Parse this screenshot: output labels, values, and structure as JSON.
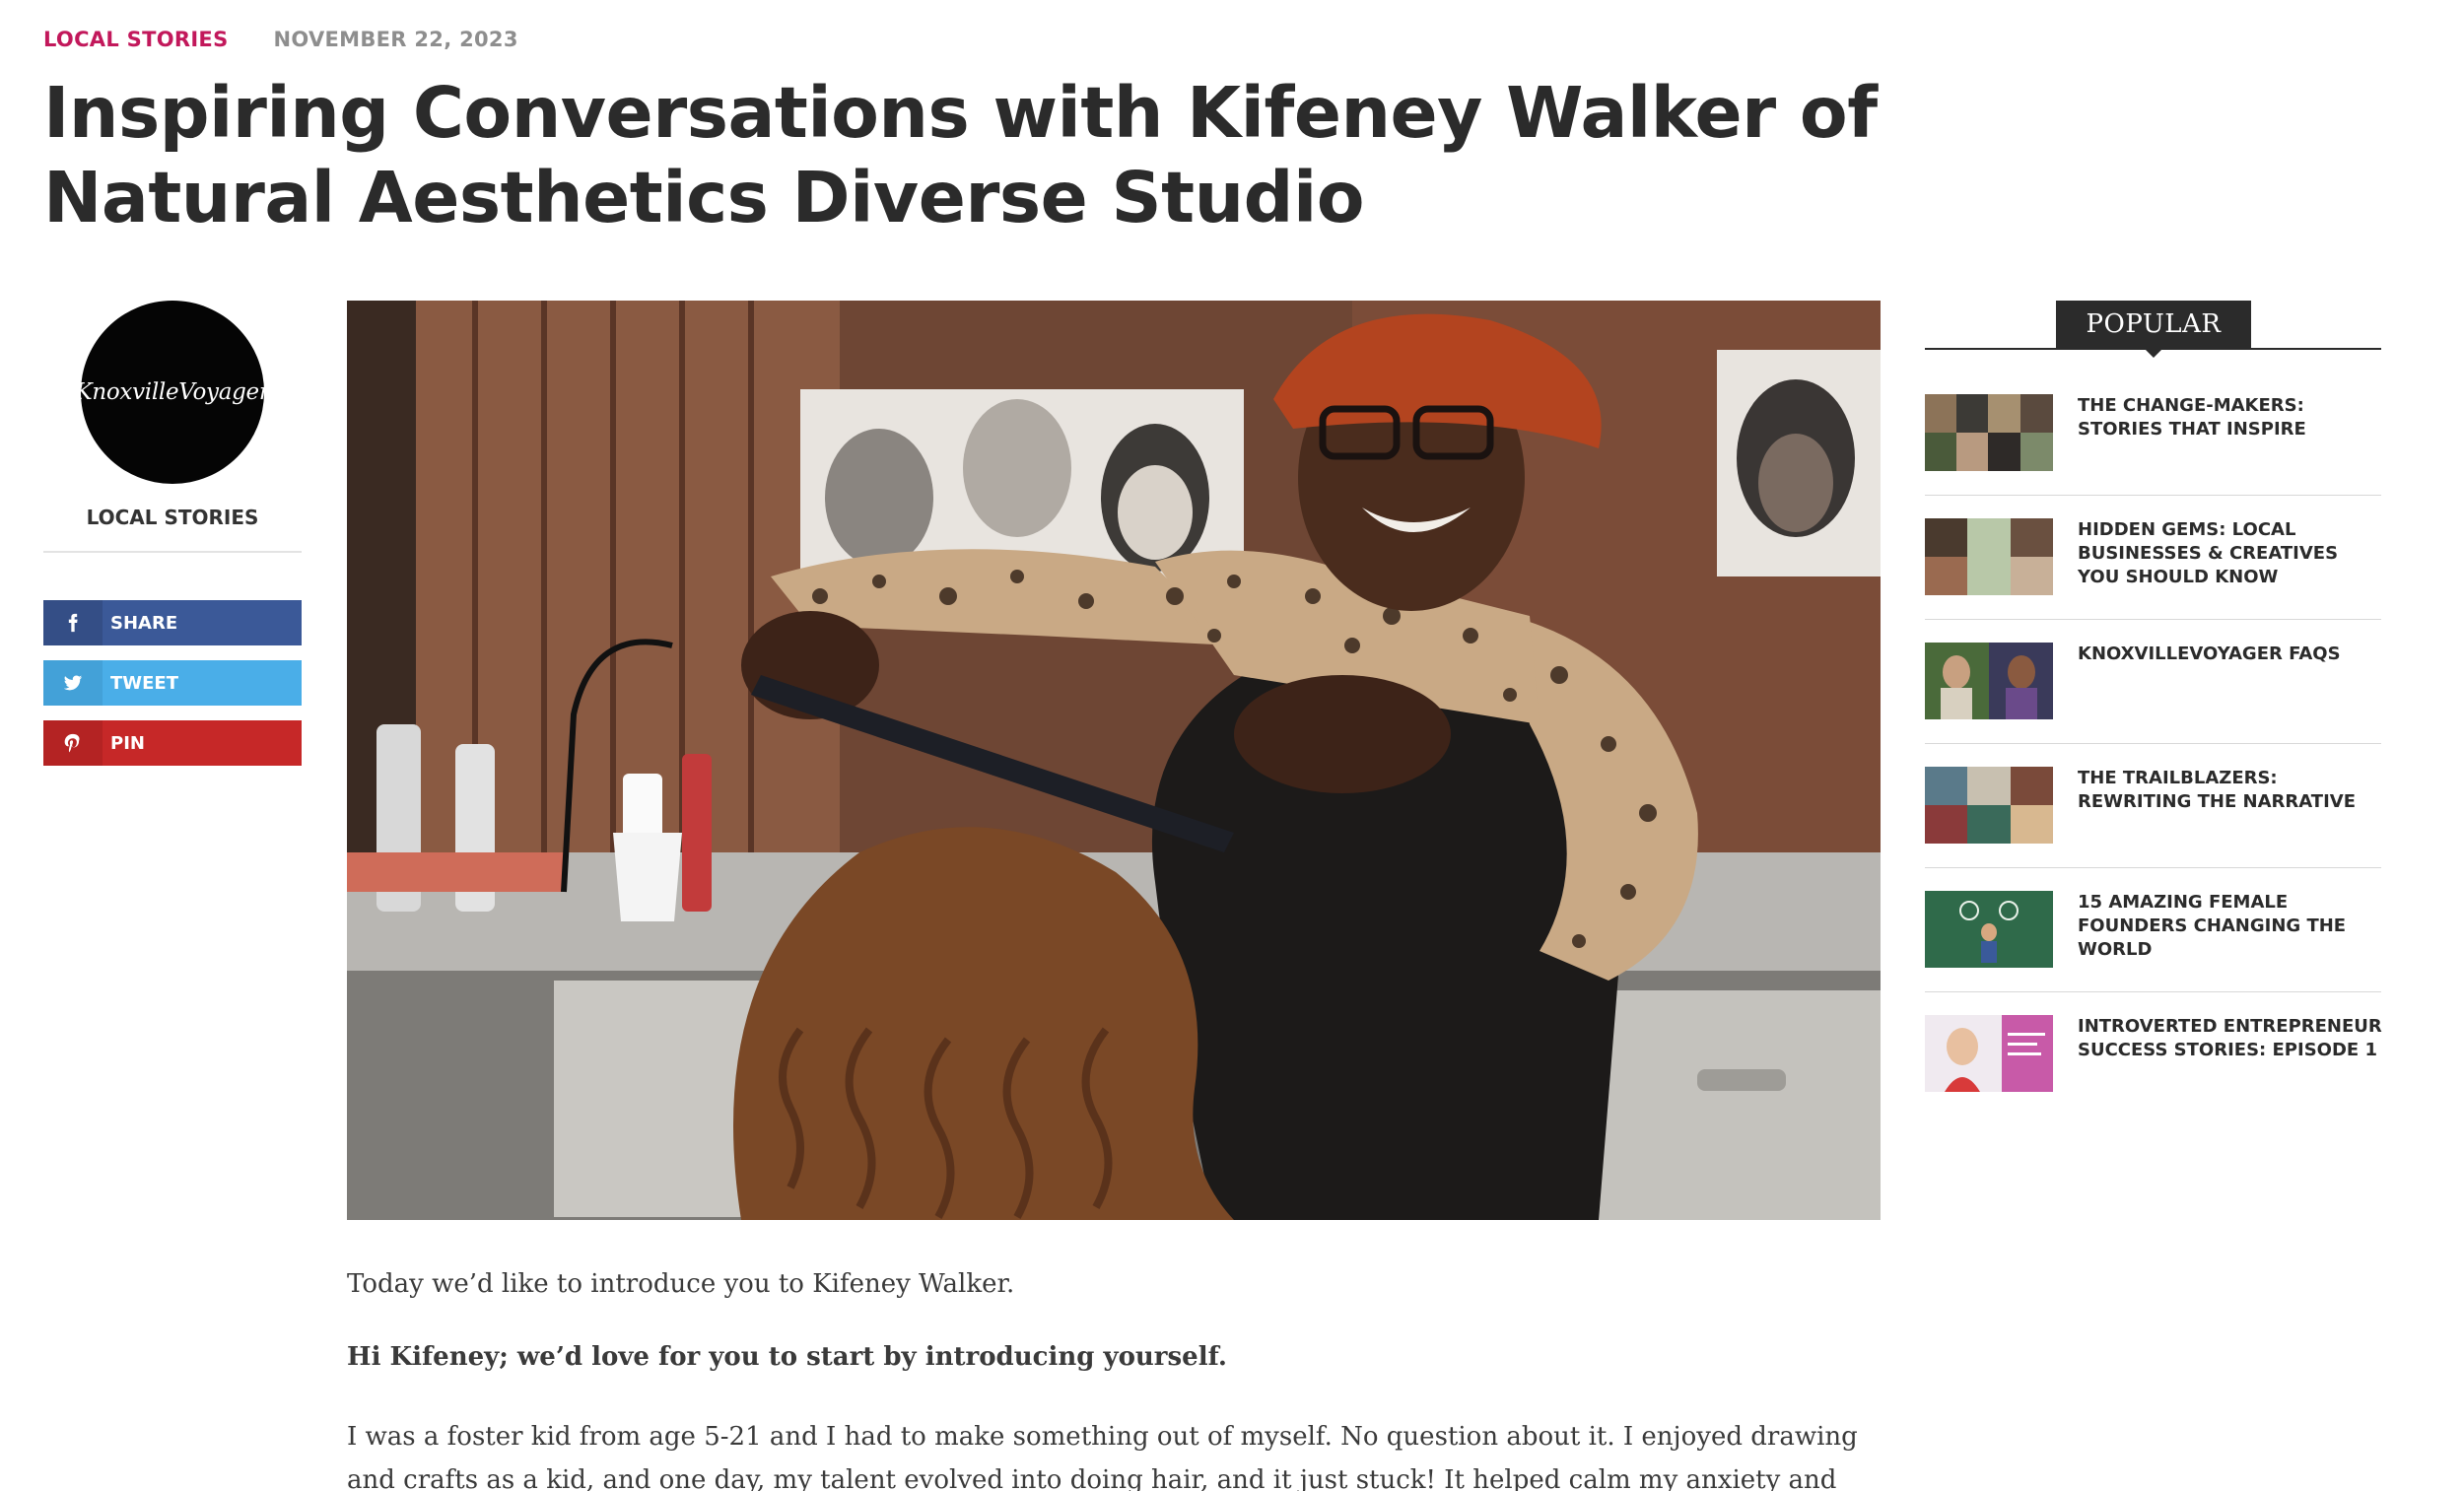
{
  "article": {
    "category": "LOCAL STORIES",
    "date": "NOVEMBER 22, 2023",
    "title": "Inspiring Conversations with Kifeney Walker of Natural Aesthetics Diverse Studio"
  },
  "author": {
    "logo_text": "KnoxvilleVoyager",
    "category": "LOCAL STORIES"
  },
  "share": {
    "facebook": {
      "label": "SHARE",
      "icon": "facebook-icon",
      "color": "#3b5998"
    },
    "twitter": {
      "label": "TWEET",
      "icon": "twitter-icon",
      "color": "#4aaee8"
    },
    "pinterest": {
      "label": "PIN",
      "icon": "pinterest-icon",
      "color": "#c62828"
    }
  },
  "body": {
    "intro": "Today we’d like to introduce you to Kifeney Walker.",
    "question": "Hi Kifeney; we’d love for you to start by introducing yourself.",
    "answer": "I was a foster kid from age 5-21 and I had to make something out of myself. No question about it. I enjoyed drawing and crafts as a kid, and one day, my talent evolved into doing hair, and it just stuck! It helped calm my anxiety and gave me a boost in knowing"
  },
  "sidebar": {
    "heading": "POPULAR",
    "items": [
      {
        "title": "THE CHANGE-MAKERS: STORIES THAT INSPIRE"
      },
      {
        "title": "HIDDEN GEMS: LOCAL BUSINESSES & CREATIVES YOU SHOULD KNOW"
      },
      {
        "title": "KNOXVILLEVOYAGER FAQS"
      },
      {
        "title": "THE TRAILBLAZERS: REWRITING THE NARRATIVE"
      },
      {
        "title": "15 AMAZING FEMALE FOUNDERS CHANGING THE WORLD"
      },
      {
        "title": "INTROVERTED ENTREPRENEUR SUCCESS STORIES: EPISODE 1"
      }
    ]
  },
  "colors": {
    "accent": "#c2185b",
    "title": "#2b2b2b",
    "date": "#8e8e8e"
  }
}
